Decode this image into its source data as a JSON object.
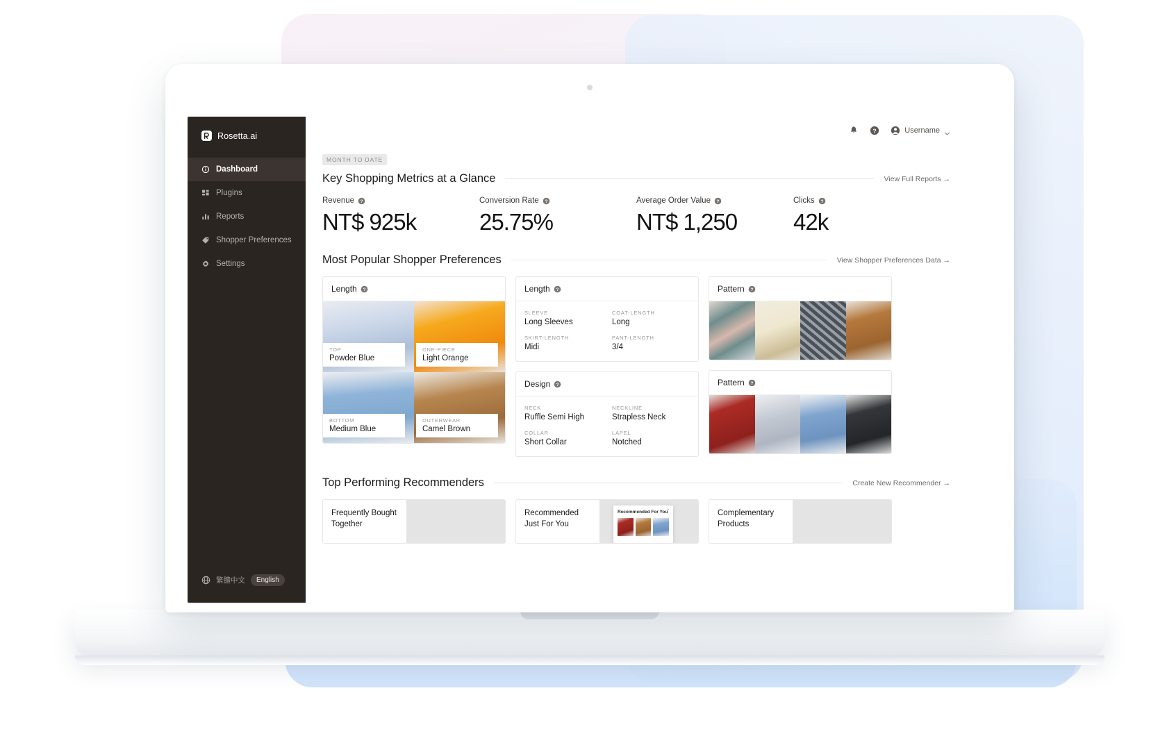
{
  "sidebar": {
    "brand": "Rosetta.ai",
    "items": [
      {
        "label": "Dashboard",
        "icon": "dashboard-icon"
      },
      {
        "label": "Plugins",
        "icon": "plugins-icon"
      },
      {
        "label": "Reports",
        "icon": "reports-icon"
      },
      {
        "label": "Shopper Preferences",
        "icon": "tag-icon"
      },
      {
        "label": "Settings",
        "icon": "gear-icon"
      }
    ],
    "language": {
      "icon": "globe-icon",
      "alternate": "繁體中文",
      "current": "English"
    }
  },
  "topbar": {
    "notifications_icon": "bell-icon",
    "help_icon": "help-icon",
    "avatar_icon": "user-avatar-icon",
    "username": "Username",
    "chevron_icon": "chevron-down-icon"
  },
  "metrics_section": {
    "pill": "MONTH TO DATE",
    "title": "Key Shopping Metrics at a Glance",
    "link": "View Full Reports →",
    "metrics": [
      {
        "label": "Revenue",
        "value": "NT$ 925k"
      },
      {
        "label": "Conversion Rate",
        "value": "25.75%"
      },
      {
        "label": "Average Order Value",
        "value": "NT$ 1,250"
      },
      {
        "label": "Clicks",
        "value": "42k"
      }
    ]
  },
  "preferences_section": {
    "title": "Most Popular Shopper Preferences",
    "link": "View Shopper Preferences Data →",
    "length_gallery": {
      "title": "Length",
      "tiles": [
        {
          "key": "TOP",
          "value": "Powder Blue"
        },
        {
          "key": "ONE-PIECE",
          "value": "Light Orange"
        },
        {
          "key": "BOTTOM",
          "value": "Medium Blue"
        },
        {
          "key": "OUTERWEAR",
          "value": "Camel Brown"
        }
      ]
    },
    "length_attrs": {
      "title": "Length",
      "attrs": [
        {
          "key": "SLEEVE",
          "value": "Long Sleeves"
        },
        {
          "key": "COAT-LENGTH",
          "value": "Long"
        },
        {
          "key": "SKIRT-LENGTH",
          "value": "Midi"
        },
        {
          "key": "PANT-LENGTH",
          "value": "3/4"
        }
      ]
    },
    "design_attrs": {
      "title": "Design",
      "attrs": [
        {
          "key": "NECK",
          "value": "Ruffle Semi High"
        },
        {
          "key": "NECKLINE",
          "value": "Strapless Neck"
        },
        {
          "key": "COLLAR",
          "value": "Short Collar"
        },
        {
          "key": "LAPEL",
          "value": "Notched"
        }
      ]
    },
    "pattern_top": {
      "title": "Pattern"
    },
    "pattern_bottom": {
      "title": "Pattern"
    }
  },
  "recommenders_section": {
    "title": "Top Performing Recommenders",
    "link": "Create New Recommender →",
    "items": [
      {
        "label": "Frequently Bought\nTogether"
      },
      {
        "label": "Recommended\nJust For You",
        "popup_title": "Recommended For You",
        "popup_close": "×"
      },
      {
        "label": "Complementary\nProducts"
      }
    ]
  },
  "colors": {
    "sidebar_bg": "#2b2522",
    "sidebar_active": "#3c3430",
    "text_primary": "#1d1b1a",
    "text_muted": "#9a9a9a",
    "border": "#e7e7e7"
  }
}
